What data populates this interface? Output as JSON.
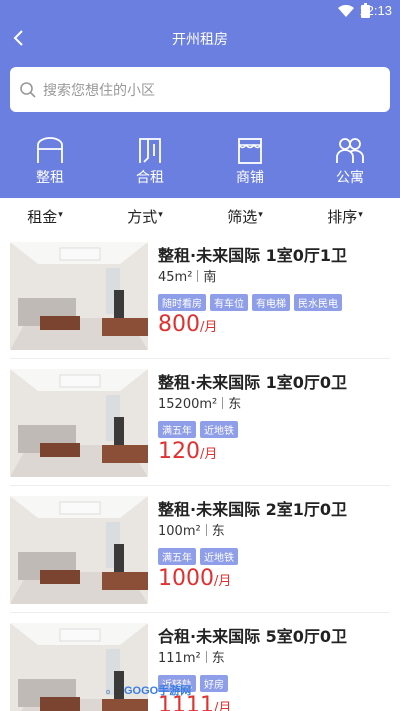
{
  "status_bar": {
    "time": "12:13"
  },
  "nav": {
    "title": "开州租房"
  },
  "search": {
    "placeholder": "搜索您想住的小区"
  },
  "categories": [
    {
      "label": "整租",
      "icon": "house-arch-icon"
    },
    {
      "label": "合租",
      "icon": "door-icon"
    },
    {
      "label": "商铺",
      "icon": "shop-awning-icon"
    },
    {
      "label": "公寓",
      "icon": "people-icon"
    }
  ],
  "filters": [
    {
      "label": "租金"
    },
    {
      "label": "方式"
    },
    {
      "label": "筛选"
    },
    {
      "label": "排序"
    }
  ],
  "listings": [
    {
      "title": "整租·未来国际 1室0厅1卫",
      "area": "45m²",
      "orientation": "南",
      "tags": [
        "随时看房",
        "有车位",
        "有电梯",
        "民水民电"
      ],
      "price": "800",
      "price_unit": "/月"
    },
    {
      "title": "整租·未来国际 1室0厅0卫",
      "area": "15200m²",
      "orientation": "东",
      "tags": [
        "满五年",
        "近地铁"
      ],
      "price": "120",
      "price_unit": "/月"
    },
    {
      "title": "整租·未来国际 2室1厅0卫",
      "area": "100m²",
      "orientation": "东",
      "tags": [
        "满五年",
        "近地铁"
      ],
      "price": "1000",
      "price_unit": "/月"
    },
    {
      "title": "合租·未来国际 5室0厅0卫",
      "area": "111m²",
      "orientation": "东",
      "tags": [
        "近轻轨",
        "好房"
      ],
      "price": "1111",
      "price_unit": "/月"
    }
  ],
  "watermark": {
    "text": "GOGO手游网"
  },
  "colors": {
    "header": "#6b7fe0",
    "tag_bg": "#8f9ee8",
    "price": "#e03030"
  }
}
